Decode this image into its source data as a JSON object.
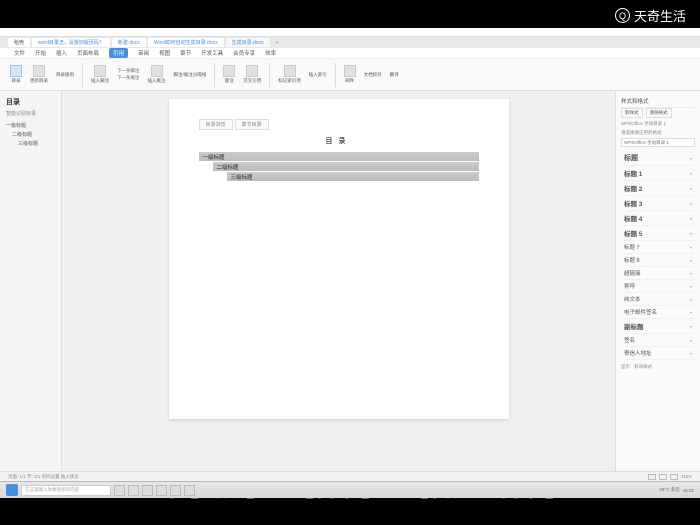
{
  "watermark": "天奇生活",
  "tabs": [
    {
      "label": "稻壳",
      "blue": false
    },
    {
      "label": "word目录怎，设置旧版页码？",
      "blue": true
    },
    {
      "label": "新建 docx",
      "blue": true
    },
    {
      "label": "Word如何自动生成目录.docx",
      "blue": true
    },
    {
      "label": "生成目录.docx",
      "blue": true,
      "active": true
    }
  ],
  "menus": [
    "文件",
    "开始",
    "插入",
    "页面布局",
    "引用",
    "审阅",
    "视图",
    "章节",
    "开发工具",
    "会员专享",
    "效率"
  ],
  "active_menu_index": 4,
  "ribbon": {
    "toc": "目录",
    "update": "更新目录",
    "level": "目录级别",
    "insert_note": "插入脚注",
    "next_note": "下一条脚注",
    "insert_end": "插入尾注",
    "next_end": "下一条尾注",
    "sep": "脚注/尾注分隔线",
    "caption": "题注",
    "cross": "交叉引用",
    "mark": "标记索引项",
    "insert_idx": "插入索引",
    "mail": "邮件",
    "doc_check": "文档校对",
    "translate": "翻译"
  },
  "left_panel": {
    "title": "目录",
    "tab2": "智能识别目录",
    "items": [
      {
        "text": "一级标题",
        "indent": 0
      },
      {
        "text": "二级标题",
        "indent": 1
      },
      {
        "text": "三级标题",
        "indent": 2
      }
    ]
  },
  "doc": {
    "tabs": [
      "目录浏览",
      "章节目录"
    ],
    "title": "目录",
    "entries": [
      {
        "text": "一级标题",
        "lvl": 1
      },
      {
        "text": "二级标题",
        "lvl": 2
      },
      {
        "text": "三级标题",
        "lvl": 3
      }
    ]
  },
  "right_panel": {
    "header": "样式和格式",
    "btn1": "新样式",
    "btn2": "清除格式",
    "section1": "WPSOffice 手动目录 1",
    "section2": "请选择要应用的格式",
    "search_ph": "WPSOffice 手动目录 1",
    "styles": [
      {
        "label": "标题",
        "cls": "style-big"
      },
      {
        "label": "标题 1",
        "cls": "style-bold"
      },
      {
        "label": "标题 2",
        "cls": "style-bold"
      },
      {
        "label": "标题 3",
        "cls": "style-bold"
      },
      {
        "label": "标题 4",
        "cls": "style-bold"
      },
      {
        "label": "标题 5",
        "cls": "style-bold"
      },
      {
        "label": "标题 7",
        "cls": ""
      },
      {
        "label": "标题 8",
        "cls": ""
      },
      {
        "label": "超链接",
        "cls": ""
      },
      {
        "label": "称呼",
        "cls": ""
      },
      {
        "label": "纯文本",
        "cls": ""
      },
      {
        "label": "电子邮件签名",
        "cls": ""
      },
      {
        "label": "副标题",
        "cls": "style-bold"
      },
      {
        "label": "签名",
        "cls": ""
      },
      {
        "label": "寄信人地址",
        "cls": ""
      }
    ],
    "footer_label": "显示",
    "footer_value": "有效样式"
  },
  "statusbar": {
    "left": "页面: 1/1  节: 1/1  页码设置  插入状态",
    "zoom": "115%"
  },
  "taskbar": {
    "search": "在这里输入你要搜索的内容",
    "weather": "29°C 多云",
    "time": "15:02"
  },
  "subtitle": "点击【引用】→【目录】→【自定义目录】"
}
